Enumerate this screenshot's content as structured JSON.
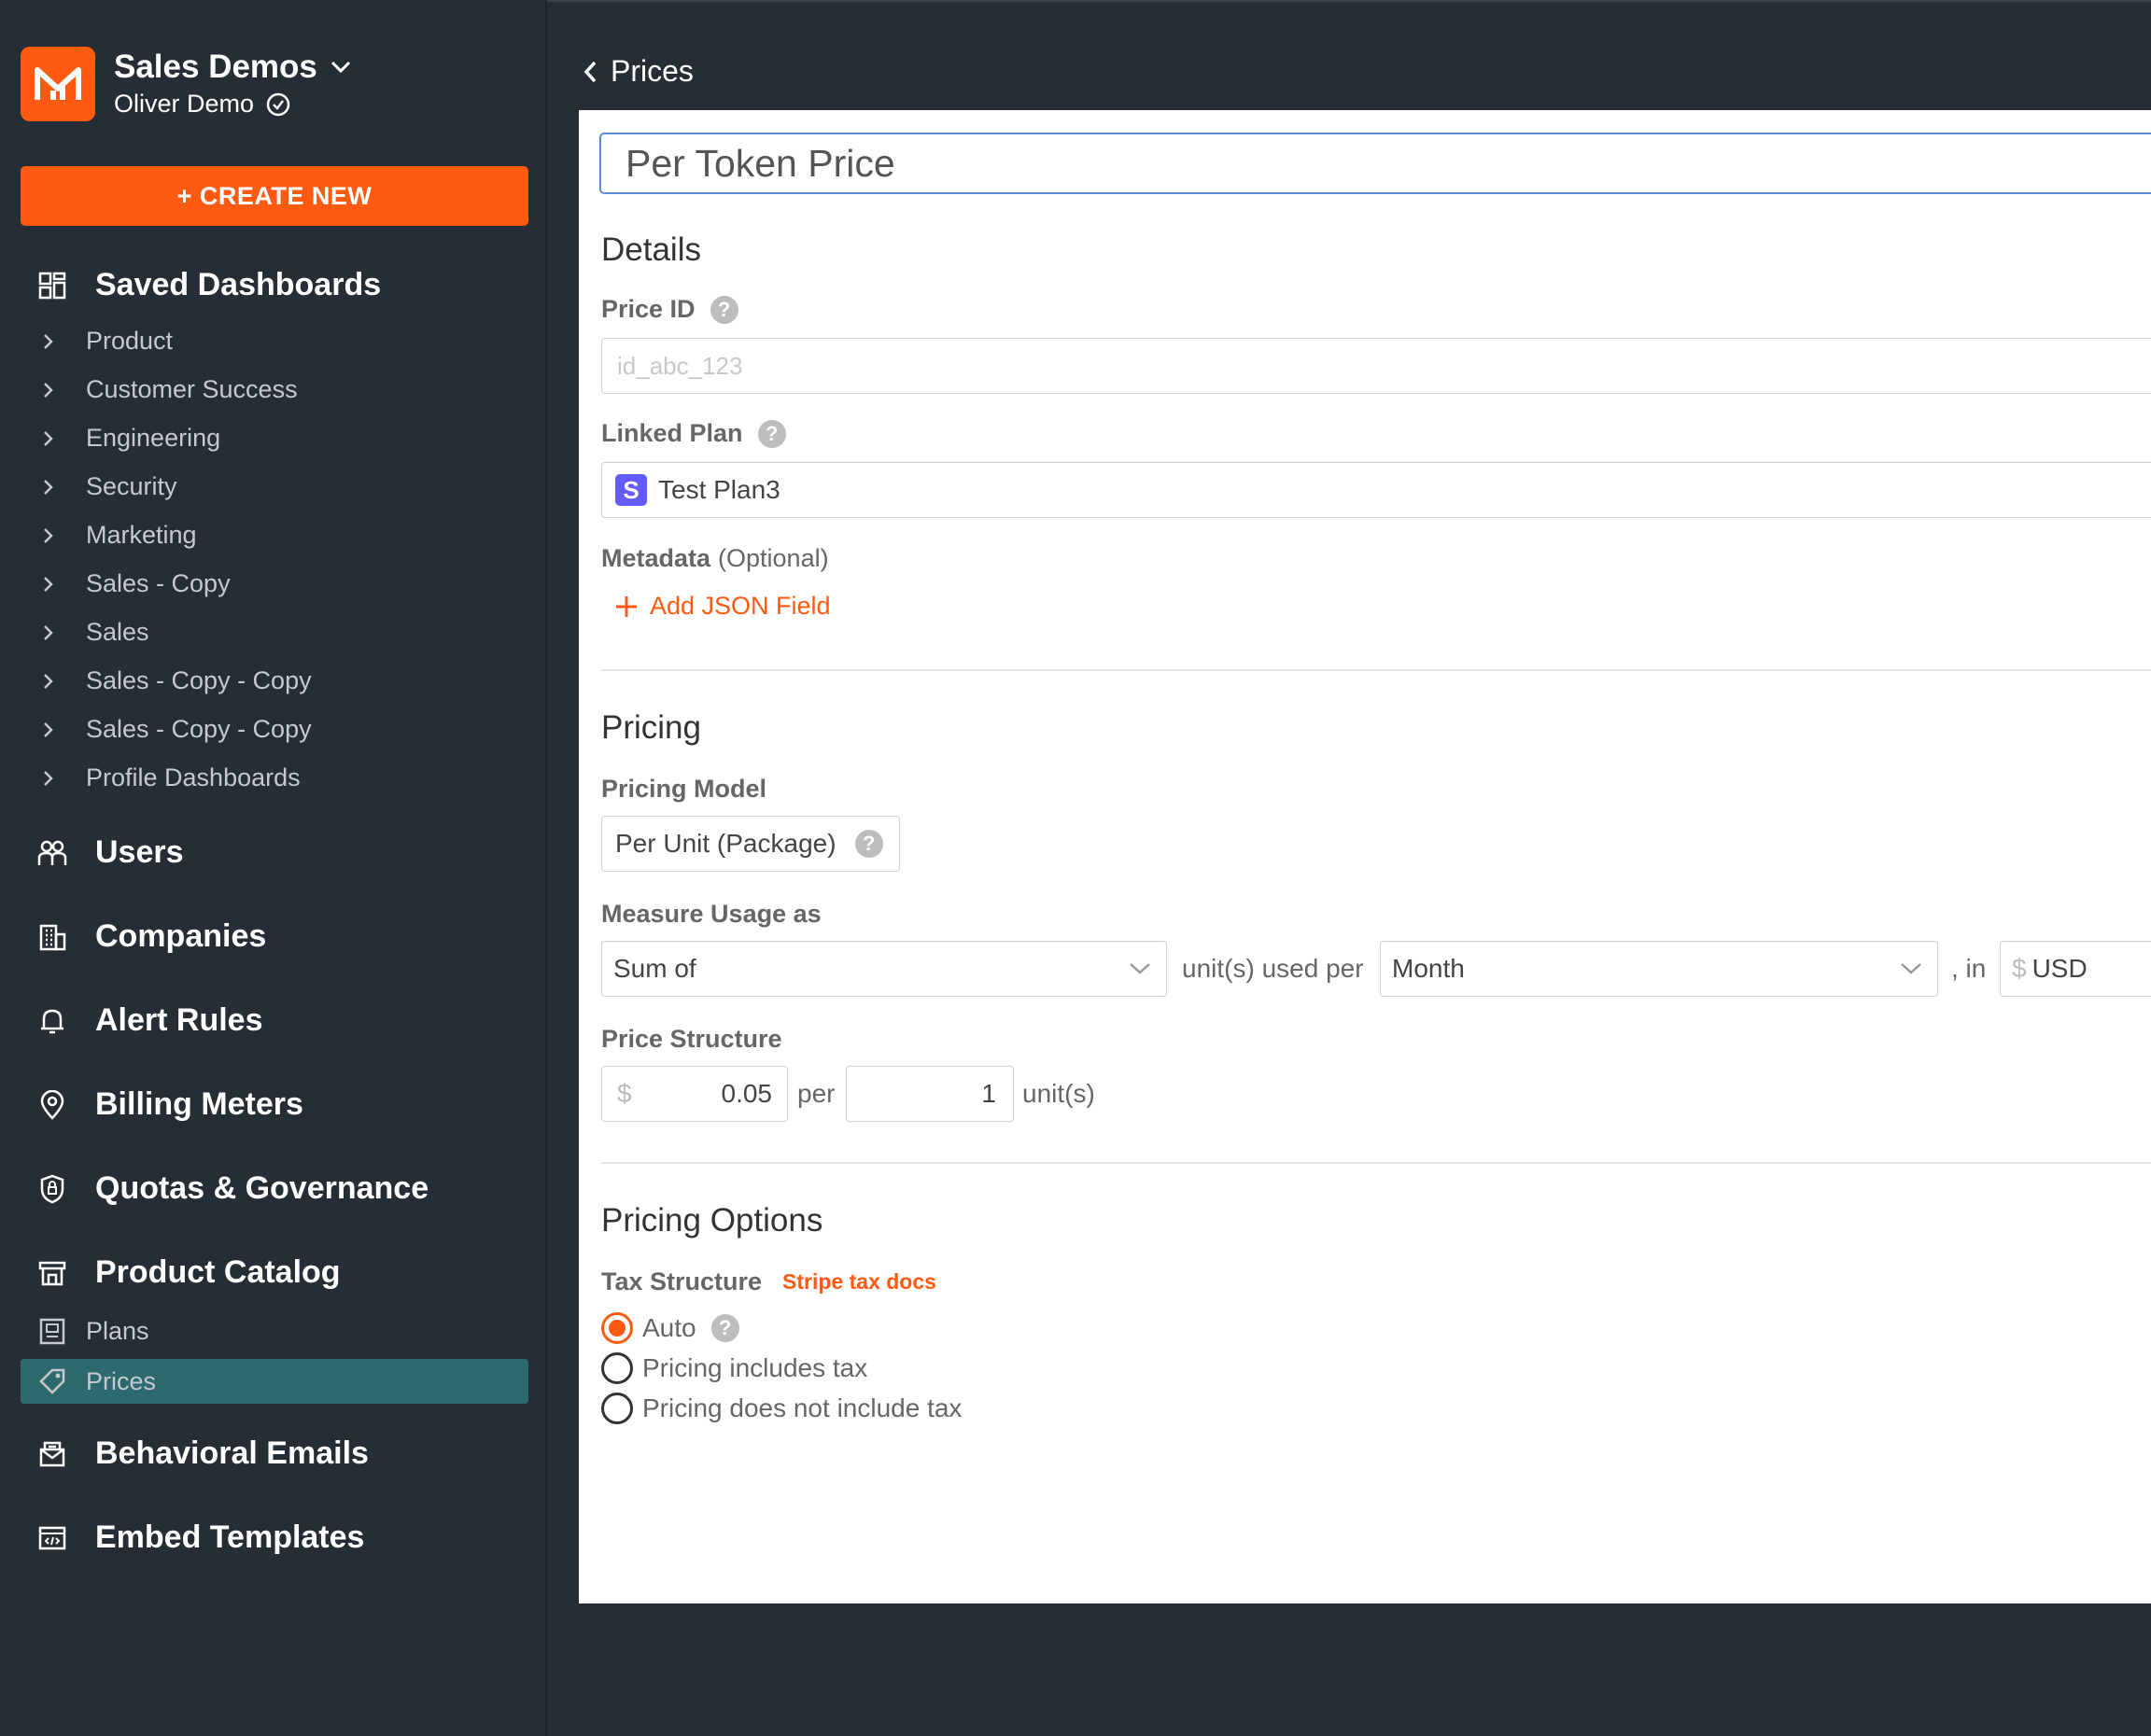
{
  "org": {
    "name": "Sales Demos",
    "user": "Oliver Demo"
  },
  "create_button": "+ CREATE NEW",
  "saved_dashboards": {
    "title": "Saved Dashboards",
    "items": [
      "Product",
      "Customer Success",
      "Engineering",
      "Security",
      "Marketing",
      "Sales - Copy",
      "Sales",
      "Sales - Copy - Copy",
      "Sales - Copy - Copy",
      "Profile Dashboards"
    ]
  },
  "nav": {
    "users": "Users",
    "companies": "Companies",
    "alert_rules": "Alert Rules",
    "billing_meters": "Billing Meters",
    "quotas": "Quotas & Governance",
    "product_catalog": "Product Catalog",
    "plans": "Plans",
    "prices": "Prices",
    "behavioral_emails": "Behavioral Emails",
    "embed_templates": "Embed Templates"
  },
  "back_link": "Prices",
  "form": {
    "title": "Per Token Price",
    "details_heading": "Details",
    "price_id_label": "Price ID",
    "price_id_placeholder": "id_abc_123",
    "linked_plan_label": "Linked Plan",
    "linked_plan_badge": "S",
    "linked_plan_value": "Test Plan3",
    "metadata_label": "Metadata",
    "metadata_optional": "(Optional)",
    "add_json": "Add JSON Field",
    "pricing_heading": "Pricing",
    "pricing_model_label": "Pricing Model",
    "pricing_model_value": "Per Unit (Package)",
    "measure_label": "Measure Usage as",
    "measure_aggregate": "Sum of",
    "units_used_per": "unit(s) used per",
    "period": "Month",
    "in_text": ", in",
    "currency_symbol": "$",
    "currency": "USD",
    "price_structure_label": "Price Structure",
    "price_symbol": "$",
    "price_value": "0.05",
    "per_text": "per",
    "unit_qty": "1",
    "units_text": "unit(s)",
    "options_heading": "Pricing Options",
    "tax_label": "Tax Structure",
    "tax_docs": "Stripe tax docs",
    "tax_options": [
      "Auto",
      "Pricing includes tax",
      "Pricing does not include tax"
    ],
    "tax_selected": "Auto"
  },
  "colors": {
    "accent": "#ff5a12",
    "sidebar": "#272d34",
    "active": "#2d6a6e"
  }
}
